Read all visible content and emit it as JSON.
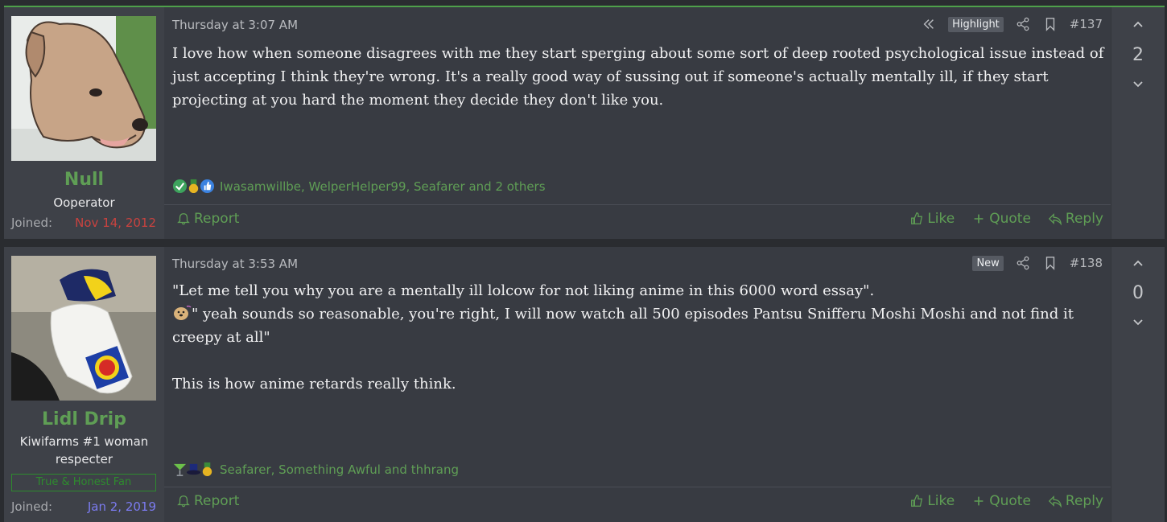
{
  "posts": [
    {
      "user": {
        "name": "Null",
        "title": "Ooperator",
        "banner": "",
        "joined_label": "Joined:",
        "joined_date": "Nov 14, 2012"
      },
      "date": "Thursday at 3:07 AM",
      "badge": "Highlight",
      "number": "#137",
      "message": [
        "I love how when someone disagrees with me they start sperging about some sort of deep rooted psychological issue instead of just accepting I think they're wrong. It's a really good way of sussing out if someone's actually mentally ill, if they start projecting at you hard the moment they decide they don't like you."
      ],
      "reactions": "Iwasamwillbe, WelperHelper99, Seafarer and 2 others",
      "score": "2",
      "actions": {
        "report": "Report",
        "like": "Like",
        "quote": "Quote",
        "reply": "Reply"
      }
    },
    {
      "user": {
        "name": "Lidl Drip",
        "title": "Kiwifarms #1 woman respecter",
        "banner": "True & Honest Fan",
        "joined_label": "Joined:",
        "joined_date": "Jan 2, 2019"
      },
      "date": "Thursday at 3:53 AM",
      "badge": "New",
      "number": "#138",
      "message": [
        "\"Let me tell you why you are a mentally ill lolcow for not liking anime in this 6000 word essay\".",
        "\" yeah sounds so reasonable, you're right, I will now watch all 500 episodes Pantsu Snifferu Moshi Moshi and not find it creepy at all\"",
        "This is how anime retards really think."
      ],
      "reactions": "Seafarer, Something Awful and thhrang",
      "score": "0",
      "actions": {
        "report": "Report",
        "like": "Like",
        "quote": "Quote",
        "reply": "Reply"
      }
    }
  ],
  "colors": {
    "accent": "#5f9e55",
    "joined_date_1": "#c9423f",
    "joined_date_2": "#7b7bf0",
    "banner": "#2e8b2e"
  },
  "icons": [
    "rewind-icon",
    "share-icon",
    "bookmark-icon",
    "bell-icon",
    "thumbs-up-icon",
    "plus-icon",
    "reply-icon",
    "chevron-up-icon",
    "chevron-down-icon"
  ]
}
